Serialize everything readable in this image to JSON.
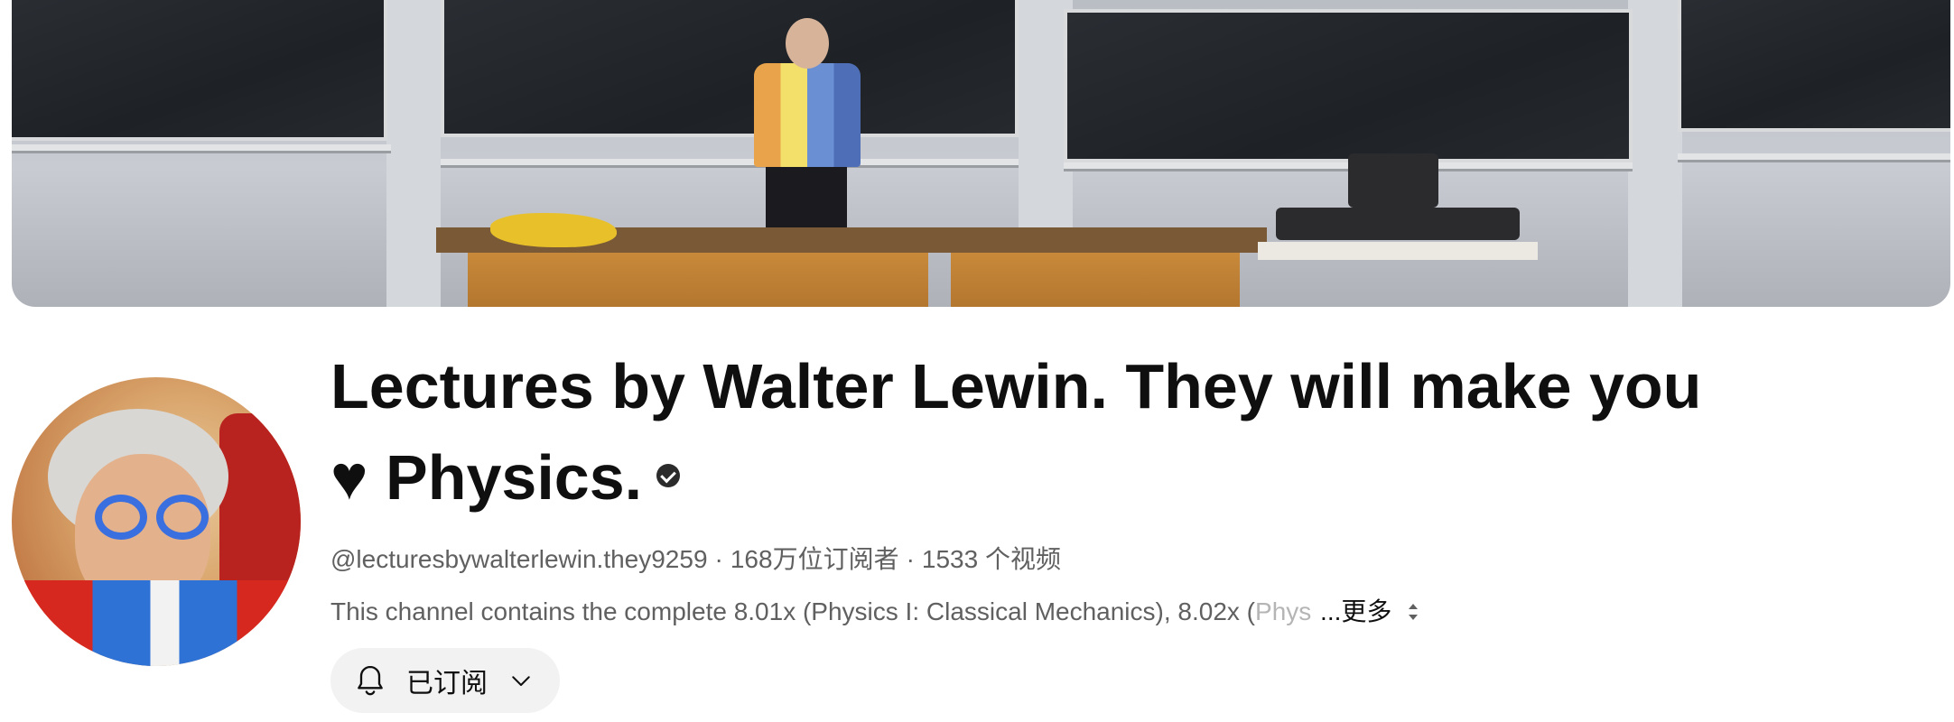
{
  "banner": {
    "alt": ""
  },
  "channel": {
    "title": "Lectures by Walter Lewin. They will make you ♥ Physics.",
    "verified": true,
    "handle": "@lecturesbywalterlewin.they9259",
    "subscribers": "168万位订阅者",
    "videos": "1533 个视频",
    "separator": "·",
    "description_visible": "This channel contains the complete 8.01x (Physics I: Classical Mechanics), 8.02x (",
    "description_faded": "Phys",
    "more_label": "...更多"
  },
  "subscribe_button": {
    "label": "已订阅"
  },
  "icons": {
    "verified": "verified-check-icon",
    "bell": "bell-icon",
    "chevron": "chevron-down-icon",
    "sort": "sort-updown-icon"
  }
}
